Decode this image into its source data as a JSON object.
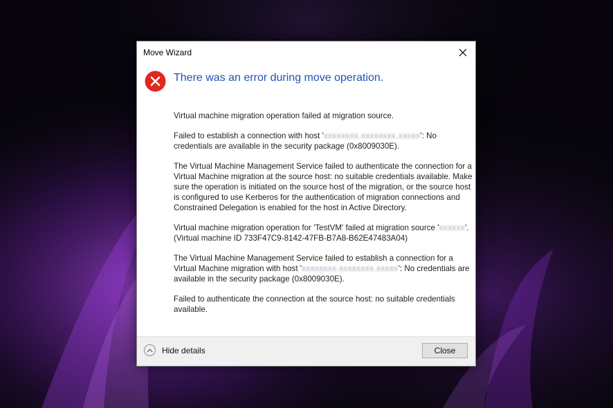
{
  "dialog": {
    "title": "Move Wizard",
    "heading": "There was an error during move operation.",
    "paragraphs": {
      "p1": "Virtual machine migration operation failed at migration source.",
      "p2_pre": "Failed to establish a connection with host '",
      "p2_post": "': No credentials are available in the security package (0x8009030E).",
      "p3": "The Virtual Machine Management Service failed to authenticate the connection for a Virtual Machine migration at the source host: no suitable credentials available. Make sure the operation is initiated on the source host of the migration, or the source host is configured to use Kerberos for the authentication of migration connections and Constrained Delegation is enabled for the host in Active Directory.",
      "p4_pre": "Virtual machine migration operation for 'TestVM' failed at migration source '",
      "p4_post": "'. (Virtual machine ID 733F47C9-8142-47FB-B7A8-B62E47483A04)",
      "p5_pre": "The Virtual Machine Management Service failed to establish a connection for a Virtual Machine migration with host '",
      "p5_post": "': No credentials are available in the security package (0x8009030E).",
      "p6": "Failed to authenticate the connection at the source host: no suitable credentials available."
    },
    "footer": {
      "hide_details_label": "Hide details",
      "close_label": "Close"
    }
  },
  "icons": {
    "error": "error-icon",
    "window_close": "close-icon",
    "toggle": "chevron-up-icon"
  },
  "colors": {
    "heading": "#1f52b5",
    "error_red": "#e0281f",
    "background": "#07050b",
    "wallpaper_glow": "#8a2fd1"
  }
}
